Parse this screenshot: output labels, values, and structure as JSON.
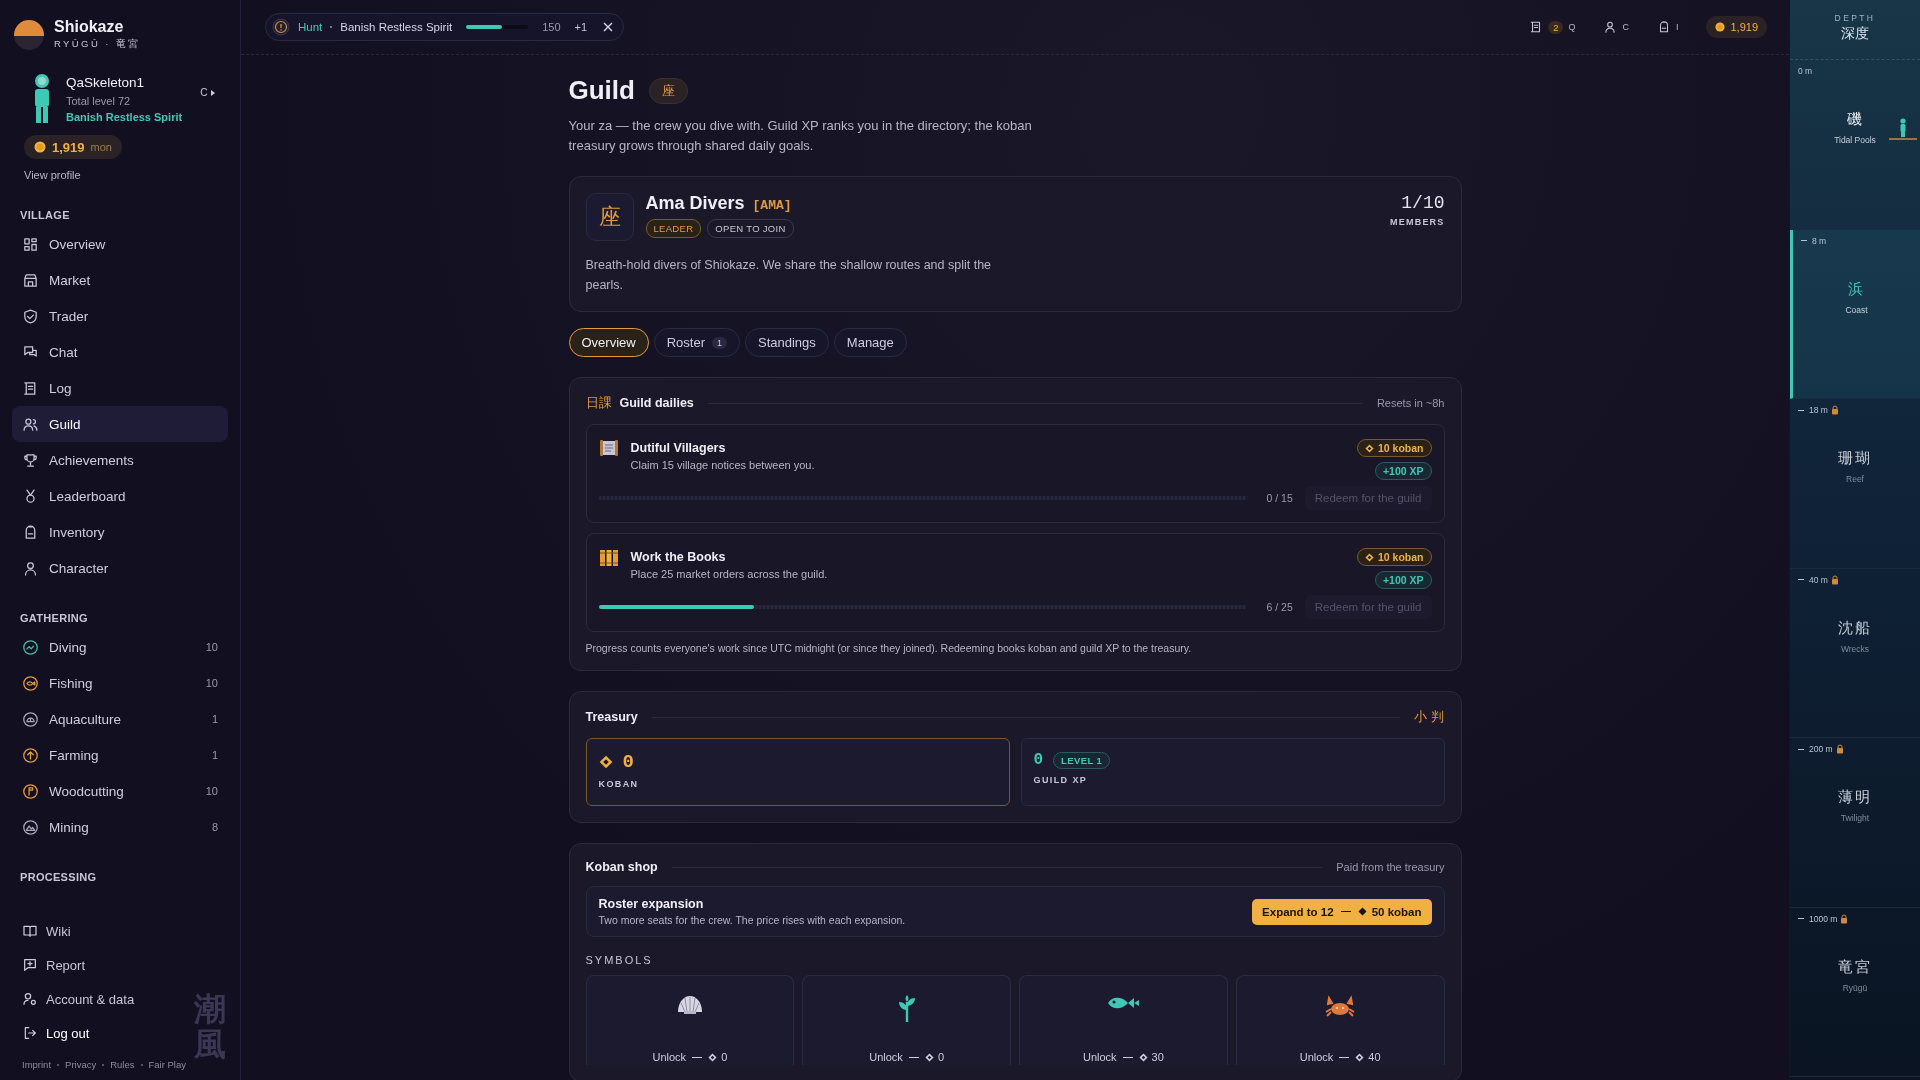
{
  "brand": {
    "name": "Shiokaze",
    "subtitle": "RYŪGŪ · 竜宮"
  },
  "profile": {
    "name": "QaSkeleton1",
    "level": "Total level 72",
    "title": "Banish Restless Spirit",
    "hotkey": "C",
    "coins": "1,919",
    "coin_unit": "mon",
    "link": "View profile"
  },
  "nav_sections": [
    {
      "heading": "VILLAGE",
      "items": [
        {
          "label": "Overview",
          "kind": "grid",
          "selected": false
        },
        {
          "label": "Market",
          "kind": "store",
          "selected": false
        },
        {
          "label": "Trader",
          "kind": "shield",
          "selected": false
        },
        {
          "label": "Chat",
          "kind": "chat",
          "selected": false
        },
        {
          "label": "Log",
          "kind": "scroll",
          "selected": false
        },
        {
          "label": "Guild",
          "kind": "people",
          "selected": true
        },
        {
          "label": "Achievements",
          "kind": "trophy",
          "selected": false
        },
        {
          "label": "Leaderboard",
          "kind": "medal",
          "selected": false
        },
        {
          "label": "Inventory",
          "kind": "backpack",
          "selected": false
        },
        {
          "label": "Character",
          "kind": "person",
          "selected": false
        }
      ]
    },
    {
      "heading": "GATHERING",
      "items": [
        {
          "label": "Diving",
          "kind": "wave",
          "count": "10",
          "selected": false
        },
        {
          "label": "Fishing",
          "kind": "fish",
          "count": "10",
          "selected": false
        },
        {
          "label": "Aquaculture",
          "kind": "dome",
          "count": "1",
          "selected": false
        },
        {
          "label": "Farming",
          "kind": "arrow",
          "count": "1",
          "selected": false
        },
        {
          "label": "Woodcutting",
          "kind": "flag",
          "count": "10",
          "selected": false
        },
        {
          "label": "Mining",
          "kind": "mountain",
          "count": "8",
          "selected": false
        }
      ]
    },
    {
      "heading": "PROCESSING"
    }
  ],
  "bottom_links": [
    {
      "label": "Wiki",
      "kind": "book"
    },
    {
      "label": "Report",
      "kind": "report"
    },
    {
      "label": "Account & data",
      "kind": "account"
    },
    {
      "label": "Log out",
      "kind": "logout"
    }
  ],
  "footer_links": [
    "Imprint",
    "Privacy",
    "Rules",
    "Fair Play"
  ],
  "watermark": "潮風",
  "topbar": {
    "activity": {
      "label": "Hunt",
      "name": "Banish Restless Spirit",
      "level": 0.58,
      "value": "150",
      "bonus": "+1"
    },
    "indicators": [
      {
        "kind": "quests",
        "badge": "2",
        "hotkey": "Q"
      },
      {
        "kind": "character",
        "hotkey": "C"
      },
      {
        "kind": "inventory",
        "hotkey": "I"
      }
    ],
    "coins": "1,919"
  },
  "page": {
    "title": "Guild",
    "title_badge": "座",
    "intro": "Your za — the crew you dive with. Guild XP ranks you in the directory; the koban treasury grows through shared daily goals."
  },
  "guild": {
    "emblem": "座",
    "name": "Ama Divers",
    "tag": "[AMA]",
    "badges": [
      {
        "label": "LEADER",
        "kind": "role"
      },
      {
        "label": "OPEN TO JOIN",
        "kind": "status"
      }
    ],
    "members": "1/10",
    "members_label": "MEMBERS",
    "description": "Breath-hold divers of Shiokaze. We share the shallow routes and split the pearls."
  },
  "tabs": [
    {
      "label": "Overview",
      "selected": true
    },
    {
      "label": "Roster",
      "count": "1",
      "selected": false
    },
    {
      "label": "Standings",
      "selected": false
    },
    {
      "label": "Manage",
      "selected": false
    }
  ],
  "dailies": {
    "kanji": "日課",
    "title": "Guild dailies",
    "resets": "Resets in ~8h",
    "tasks": [
      {
        "kind": "notices",
        "title": "Dutiful Villagers",
        "description": "Claim 15 village notices between you.",
        "reward_koban": "10 koban",
        "reward_xp": "+100 XP",
        "level": 0,
        "progress": "0 / 15",
        "action": "Redeem for the guild",
        "disabled": true
      },
      {
        "kind": "books",
        "title": "Work the Books",
        "description": "Place 25 market orders across the guild.",
        "reward_koban": "10 koban",
        "reward_xp": "+100 XP",
        "level": 0.24,
        "progress": "6 / 25",
        "action": "Redeem for the guild",
        "disabled": true
      }
    ],
    "note": "Progress counts everyone's work since UTC midnight (or since they joined). Redeeming books koban and guild XP to the treasury."
  },
  "treasury": {
    "title": "Treasury",
    "kanji": "小 判",
    "koban": {
      "value": "0",
      "label": "KOBAN"
    },
    "xp": {
      "value": "0",
      "level": "LEVEL 1",
      "label": "GUILD XP"
    }
  },
  "shop": {
    "title": "Koban shop",
    "note": "Paid from the treasury",
    "offer": {
      "title": "Roster expansion",
      "description": "Two more seats for the crew. The price rises with each expansion.",
      "button": "Expand to 12",
      "price": "50 koban"
    },
    "symbols_heading": "SYMBOLS",
    "symbols": [
      {
        "kind": "shell",
        "action": "Unlock",
        "price": "0"
      },
      {
        "kind": "sprout",
        "action": "Unlock",
        "price": "0"
      },
      {
        "kind": "fish",
        "action": "Unlock",
        "price": "30"
      },
      {
        "kind": "crab",
        "action": "Unlock",
        "price": "40"
      }
    ]
  },
  "depth": {
    "heading": "DEPTH",
    "heading_kanji": "深度",
    "zones": [
      {
        "depth": "0 m",
        "kanji": "磯",
        "name": "Tidal Pools",
        "locked": false,
        "selected": false,
        "here": true
      },
      {
        "depth": "8 m",
        "kanji": "浜",
        "name": "Coast",
        "locked": false,
        "selected": true,
        "here": false
      },
      {
        "depth": "18 m",
        "kanji": "珊瑚",
        "name": "Reef",
        "locked": true,
        "selected": false,
        "here": false
      },
      {
        "depth": "40 m",
        "kanji": "沈船",
        "name": "Wrecks",
        "locked": true,
        "selected": false,
        "here": false
      },
      {
        "depth": "200 m",
        "kanji": "薄明",
        "name": "Twilight",
        "locked": true,
        "selected": false,
        "here": false
      },
      {
        "depth": "1000 m",
        "kanji": "竜宮",
        "name": "Ryūgū",
        "locked": true,
        "selected": false,
        "here": false
      }
    ]
  }
}
